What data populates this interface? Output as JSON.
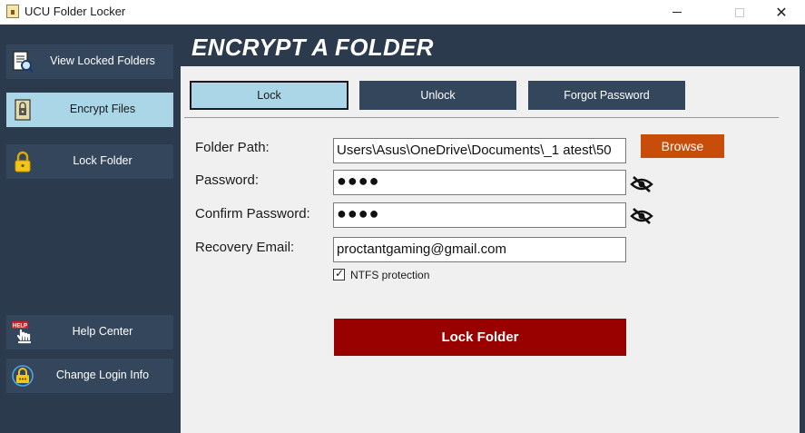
{
  "window": {
    "title": "UCU Folder Locker",
    "controls": {
      "minimize": "",
      "maximize": "",
      "close": "✕"
    }
  },
  "sidebar": {
    "items": [
      {
        "label": "View Locked Folders",
        "icon": "document-search-icon",
        "active": false
      },
      {
        "label": "Encrypt Files",
        "icon": "encrypted-file-icon",
        "active": true
      },
      {
        "label": "Lock Folder",
        "icon": "padlock-icon",
        "active": false
      },
      {
        "label": "Help Center",
        "icon": "help-hand-icon",
        "active": false
      },
      {
        "label": "Change Login Info",
        "icon": "login-lock-icon",
        "active": false
      }
    ]
  },
  "header": {
    "title": "ENCRYPT A FOLDER"
  },
  "tabs": [
    {
      "label": "Lock",
      "active": true
    },
    {
      "label": "Unlock",
      "active": false
    },
    {
      "label": "Forgot Password",
      "active": false
    }
  ],
  "form": {
    "folder_path": {
      "label": "Folder Path:",
      "value": "Users\\Asus\\OneDrive\\Documents\\_1 atest\\50"
    },
    "browse_label": "Browse",
    "password": {
      "label": "Password:",
      "value": "●●●●"
    },
    "confirm_password": {
      "label": "Confirm Password:",
      "value": "●●●●"
    },
    "recovery_email": {
      "label": "Recovery Email:",
      "value": "proctantgaming@gmail.com"
    },
    "ntfs": {
      "label": "NTFS protection",
      "checked": true,
      "check_glyph": "✓"
    },
    "submit_label": "Lock Folder"
  },
  "colors": {
    "sidebar_bg": "#2b3a4c",
    "nav_button_bg": "#34465c",
    "active_bg": "#aad6e8",
    "browse_bg": "#c84c0a",
    "submit_bg": "#990000",
    "content_bg": "#f0f0f0"
  }
}
